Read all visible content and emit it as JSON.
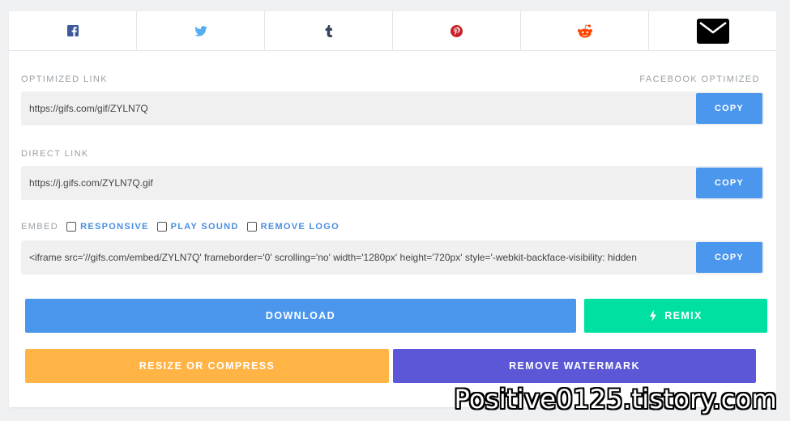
{
  "share": {
    "icons": [
      {
        "name": "facebook-icon",
        "color": "#3b5998"
      },
      {
        "name": "twitter-icon",
        "color": "#55acee"
      },
      {
        "name": "tumblr-icon",
        "color": "#35465c"
      },
      {
        "name": "pinterest-icon",
        "color": "#cb2027"
      },
      {
        "name": "reddit-icon",
        "color": "#ff4500"
      },
      {
        "name": "email-icon",
        "color": "#000000"
      }
    ]
  },
  "optimized": {
    "label": "OPTIMIZED LINK",
    "right_label": "FACEBOOK OPTIMIZED",
    "value": "https://gifs.com/gif/ZYLN7Q",
    "copy_label": "COPY"
  },
  "direct": {
    "label": "DIRECT LINK",
    "value": "https://j.gifs.com/ZYLN7Q.gif",
    "copy_label": "COPY"
  },
  "embed": {
    "label": "EMBED",
    "options": [
      "RESPONSIVE",
      "PLAY SOUND",
      "REMOVE LOGO"
    ],
    "value": "<iframe src='//gifs.com/embed/ZYLN7Q' frameborder='0' scrolling='no' width='1280px' height='720px' style='-webkit-backface-visibility: hidden",
    "copy_label": "COPY"
  },
  "actions": {
    "download": "DOWNLOAD",
    "remix": "REMIX",
    "resize": "RESIZE OR COMPRESS",
    "remove_watermark": "REMOVE WATERMARK"
  },
  "colors": {
    "blue": "#4b97ed",
    "green": "#00e0a1",
    "orange": "#ffb445",
    "purple": "#5b57d6"
  },
  "watermark": "Positive0125.tistory.com"
}
